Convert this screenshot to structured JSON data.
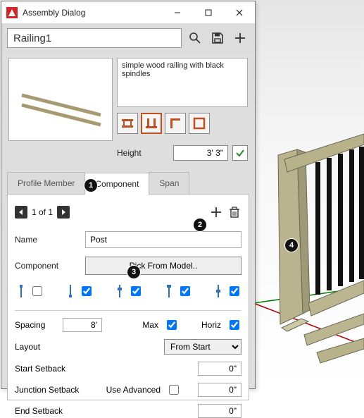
{
  "window": {
    "title": "Assembly Dialog",
    "assembly_name": "Railing1"
  },
  "info": {
    "description": "simple wood railing with black spindles",
    "height_label": "Height",
    "height_value": "3' 3\""
  },
  "tabs": {
    "profile_member": "Profile Member",
    "component": "Component",
    "span": "Span",
    "active": "Component"
  },
  "pager": {
    "text": "1 of 1"
  },
  "component_form": {
    "name_label": "Name",
    "name_value": "Post",
    "component_label": "Component",
    "pick_button": "Pick From Model.."
  },
  "position_options": {
    "opt1_checked": false,
    "opt2_checked": true,
    "opt3_checked": true,
    "opt4_checked": true,
    "opt5_checked": true
  },
  "spacing": {
    "label": "Spacing",
    "value": "8'",
    "max_label": "Max",
    "max_checked": true,
    "horiz_label": "Horiz",
    "horiz_checked": true
  },
  "layout": {
    "label": "Layout",
    "value": "From Start"
  },
  "setback": {
    "start_label": "Start Setback",
    "start_value": "0\"",
    "junction_label": "Junction Setback",
    "junction_value": "0\"",
    "use_adv_label": "Use Advanced",
    "use_adv_checked": false,
    "end_label": "End Setback",
    "end_value": "0\""
  },
  "callouts": {
    "c1": "1",
    "c2": "2",
    "c3": "3",
    "c4": "4"
  }
}
